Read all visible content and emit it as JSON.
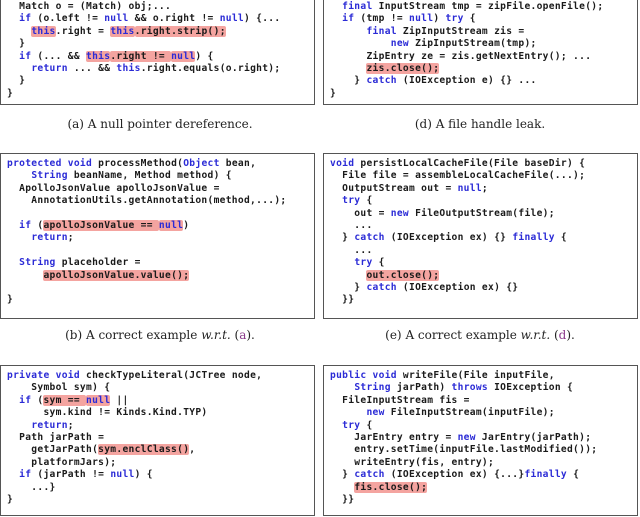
{
  "colors": {
    "keyword": "#2b2bd6",
    "highlight": "#f4a4a0",
    "text": "#1a1a1a",
    "reference": "#8a3a8a"
  },
  "panels": [
    {
      "id": "a",
      "caption": {
        "label": "(a)",
        "text": "A null pointer dereference.",
        "wrt": "",
        "ref": ""
      },
      "lines": [
        [
          [
            "  Match o = (Match) obj;...",
            ""
          ]
        ],
        [
          [
            "  ",
            ""
          ],
          [
            "if",
            "kw"
          ],
          [
            " (o.left != ",
            ""
          ],
          [
            "null",
            "kw"
          ],
          [
            " && o.right != ",
            ""
          ],
          [
            "null",
            "kw"
          ],
          [
            ") {...",
            ""
          ]
        ],
        [
          [
            "    ",
            ""
          ],
          [
            "this",
            "kw hl"
          ],
          [
            ".right = ",
            ""
          ],
          [
            "this",
            "kw hl"
          ],
          [
            ".right.strip();",
            "hl"
          ]
        ],
        [
          [
            "  }",
            ""
          ]
        ],
        [
          [
            "  ",
            ""
          ],
          [
            "if",
            "kw"
          ],
          [
            " (... && ",
            ""
          ],
          [
            "this",
            "kw hl"
          ],
          [
            ".right != ",
            "hl"
          ],
          [
            "null",
            "kw hl"
          ],
          [
            ") {",
            ""
          ]
        ],
        [
          [
            "    ",
            ""
          ],
          [
            "return",
            "kw"
          ],
          [
            " ... && ",
            ""
          ],
          [
            "this",
            "kw"
          ],
          [
            ".right.equals(o.right);",
            ""
          ]
        ],
        [
          [
            "  }",
            ""
          ]
        ],
        [
          [
            "}",
            ""
          ]
        ]
      ]
    },
    {
      "id": "d",
      "caption": {
        "label": "(d)",
        "text": "A file handle leak.",
        "wrt": "",
        "ref": ""
      },
      "lines": [
        [
          [
            "  ",
            ""
          ],
          [
            "final",
            "kw"
          ],
          [
            " InputStream tmp = zipFile.openFile();",
            ""
          ]
        ],
        [
          [
            "  ",
            ""
          ],
          [
            "if",
            "kw"
          ],
          [
            " (tmp != ",
            ""
          ],
          [
            "null",
            "kw"
          ],
          [
            ") ",
            ""
          ],
          [
            "try",
            "kw"
          ],
          [
            " {",
            ""
          ]
        ],
        [
          [
            "      ",
            ""
          ],
          [
            "final",
            "kw"
          ],
          [
            " ZipInputStream zis =",
            ""
          ]
        ],
        [
          [
            "          ",
            ""
          ],
          [
            "new",
            "kw"
          ],
          [
            " ZipInputStream(tmp);",
            ""
          ]
        ],
        [
          [
            "      ZipEntry ze = zis.getNextEntry(); ...",
            ""
          ]
        ],
        [
          [
            "      ",
            ""
          ],
          [
            "zis.close();",
            "hl"
          ]
        ],
        [
          [
            "    } ",
            ""
          ],
          [
            "catch",
            "kw"
          ],
          [
            " (IOException e) {} ...",
            ""
          ]
        ],
        [
          [
            "}",
            ""
          ]
        ]
      ]
    },
    {
      "id": "b",
      "caption": {
        "label": "(b)",
        "text": "A correct example ",
        "wrt": "w.r.t.",
        "ref": "(a)"
      },
      "lines": [
        [
          [
            "protected",
            "kw"
          ],
          [
            " ",
            ""
          ],
          [
            "void",
            "kw"
          ],
          [
            " processMethod(",
            ""
          ],
          [
            "Object",
            "kw"
          ],
          [
            " bean,",
            ""
          ]
        ],
        [
          [
            "    ",
            ""
          ],
          [
            "String",
            "kw"
          ],
          [
            " beanName, Method method) {",
            ""
          ]
        ],
        [
          [
            "  ApolloJsonValue apolloJsonValue =",
            ""
          ]
        ],
        [
          [
            "    AnnotationUtils.getAnnotation(method,...);",
            ""
          ]
        ],
        [
          [
            "",
            ""
          ]
        ],
        [
          [
            "  ",
            ""
          ],
          [
            "if",
            "kw"
          ],
          [
            " (",
            ""
          ],
          [
            "apolloJsonValue == ",
            "hl"
          ],
          [
            "null",
            "kw hl"
          ],
          [
            ")",
            ""
          ]
        ],
        [
          [
            "    ",
            ""
          ],
          [
            "return",
            "kw"
          ],
          [
            ";",
            ""
          ]
        ],
        [
          [
            "",
            ""
          ]
        ],
        [
          [
            "  ",
            ""
          ],
          [
            "String",
            "kw"
          ],
          [
            " placeholder =",
            ""
          ]
        ],
        [
          [
            "      ",
            ""
          ],
          [
            "apolloJsonValue.value();",
            "hl"
          ]
        ],
        [
          [
            "",
            ""
          ]
        ],
        [
          [
            "}",
            ""
          ]
        ]
      ]
    },
    {
      "id": "e",
      "caption": {
        "label": "(e)",
        "text": "A correct example ",
        "wrt": "w.r.t.",
        "ref": "(d)"
      },
      "lines": [
        [
          [
            "void",
            "kw"
          ],
          [
            " persistLocalCacheFile(File baseDir) {",
            ""
          ]
        ],
        [
          [
            "  File file = assembleLocalCacheFile(...);",
            ""
          ]
        ],
        [
          [
            "  OutputStream out = ",
            ""
          ],
          [
            "null",
            "kw"
          ],
          [
            ";",
            ""
          ]
        ],
        [
          [
            "  ",
            ""
          ],
          [
            "try",
            "kw"
          ],
          [
            " {",
            ""
          ]
        ],
        [
          [
            "    out = ",
            ""
          ],
          [
            "new",
            "kw"
          ],
          [
            " FileOutputStream(file);",
            ""
          ]
        ],
        [
          [
            "    ...",
            ""
          ]
        ],
        [
          [
            "  } ",
            ""
          ],
          [
            "catch",
            "kw"
          ],
          [
            " (IOException ex) {} ",
            ""
          ],
          [
            "finally",
            "kw"
          ],
          [
            " {",
            ""
          ]
        ],
        [
          [
            "    ...",
            ""
          ]
        ],
        [
          [
            "    ",
            ""
          ],
          [
            "try",
            "kw"
          ],
          [
            " {",
            ""
          ]
        ],
        [
          [
            "      ",
            ""
          ],
          [
            "out.close();",
            "hl"
          ]
        ],
        [
          [
            "    } ",
            ""
          ],
          [
            "catch",
            "kw"
          ],
          [
            " (IOException ex) {}",
            ""
          ]
        ],
        [
          [
            "  }}",
            ""
          ]
        ]
      ]
    },
    {
      "id": "c",
      "caption": null,
      "lines": [
        [
          [
            "private",
            "kw"
          ],
          [
            " ",
            ""
          ],
          [
            "void",
            "kw"
          ],
          [
            " checkTypeLiteral(JCTree node,",
            ""
          ]
        ],
        [
          [
            "    Symbol sym) {",
            ""
          ]
        ],
        [
          [
            "  ",
            ""
          ],
          [
            "if",
            "kw"
          ],
          [
            " (",
            ""
          ],
          [
            "sym == ",
            "hl"
          ],
          [
            "null",
            "kw hl"
          ],
          [
            " ||",
            ""
          ]
        ],
        [
          [
            "      sym.kind != Kinds.Kind.TYP)",
            ""
          ]
        ],
        [
          [
            "    ",
            ""
          ],
          [
            "return",
            "kw"
          ],
          [
            ";",
            ""
          ]
        ],
        [
          [
            "  Path jarPath =",
            ""
          ]
        ],
        [
          [
            "    getJarPath(",
            ""
          ],
          [
            "sym.enclClass()",
            "hl"
          ],
          [
            ",",
            ""
          ]
        ],
        [
          [
            "    platformJars);",
            ""
          ]
        ],
        [
          [
            "  ",
            ""
          ],
          [
            "if",
            "kw"
          ],
          [
            " (jarPath != ",
            ""
          ],
          [
            "null",
            "kw"
          ],
          [
            ") {",
            ""
          ]
        ],
        [
          [
            "    ...}",
            ""
          ]
        ],
        [
          [
            "}",
            ""
          ]
        ]
      ]
    },
    {
      "id": "f",
      "caption": null,
      "lines": [
        [
          [
            "public",
            "kw"
          ],
          [
            " ",
            ""
          ],
          [
            "void",
            "kw"
          ],
          [
            " writeFile(File inputFile,",
            ""
          ]
        ],
        [
          [
            "    ",
            ""
          ],
          [
            "String",
            "kw"
          ],
          [
            " jarPath) ",
            ""
          ],
          [
            "throws",
            "kw"
          ],
          [
            " IOException {",
            ""
          ]
        ],
        [
          [
            "  FileInputStream fis =",
            ""
          ]
        ],
        [
          [
            "      ",
            ""
          ],
          [
            "new",
            "kw"
          ],
          [
            " FileInputStream(inputFile);",
            ""
          ]
        ],
        [
          [
            "  ",
            ""
          ],
          [
            "try",
            "kw"
          ],
          [
            " {",
            ""
          ]
        ],
        [
          [
            "    JarEntry entry = ",
            ""
          ],
          [
            "new",
            "kw"
          ],
          [
            " JarEntry(jarPath);",
            ""
          ]
        ],
        [
          [
            "    entry.setTime(inputFile.lastModified());",
            ""
          ]
        ],
        [
          [
            "    writeEntry(fis, entry);",
            ""
          ]
        ],
        [
          [
            "  } ",
            ""
          ],
          [
            "catch",
            "kw"
          ],
          [
            " (IOException ex) {...}",
            ""
          ],
          [
            "finally",
            "kw"
          ],
          [
            " {",
            ""
          ]
        ],
        [
          [
            "    ",
            ""
          ],
          [
            "fis.close();",
            "hl"
          ]
        ],
        [
          [
            "  }}",
            ""
          ]
        ]
      ]
    }
  ]
}
